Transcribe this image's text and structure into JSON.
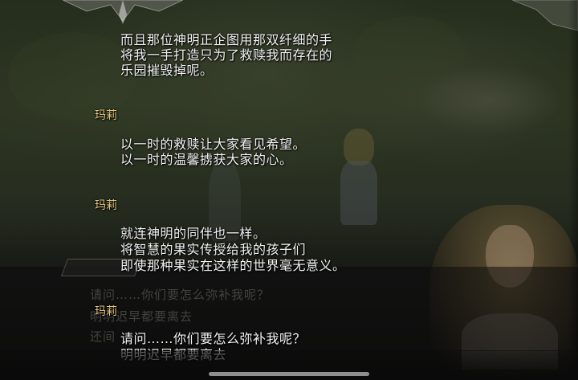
{
  "log": [
    {
      "speaker": "",
      "lines": [
        "而且那位神明正企图用那双纤细的手",
        "将我一手打造只为了救赎我而存在的",
        "乐园摧毁掉呢。"
      ]
    },
    {
      "speaker": "玛莉",
      "lines": [
        "以一时的救赎让大家看见希望。",
        "以一时的温馨掳获大家的心。"
      ]
    },
    {
      "speaker": "玛莉",
      "lines": [
        "就连神明的同伴也一样。",
        "将智慧的果实传授给我的孩子们",
        "即使那种果实在这样的世界毫无意义。"
      ]
    },
    {
      "speaker": "玛莉",
      "lines": [
        "请问……你们要怎么弥补我呢？",
        "明明迟早都要离去"
      ]
    }
  ],
  "dialogue_box": {
    "lines": [
      "请问……你们要怎么弥补我呢？",
      "明明迟早都要离去",
      "还间"
    ]
  },
  "colors": {
    "speaker": "#e3c77e",
    "text": "#f2f2f2"
  }
}
